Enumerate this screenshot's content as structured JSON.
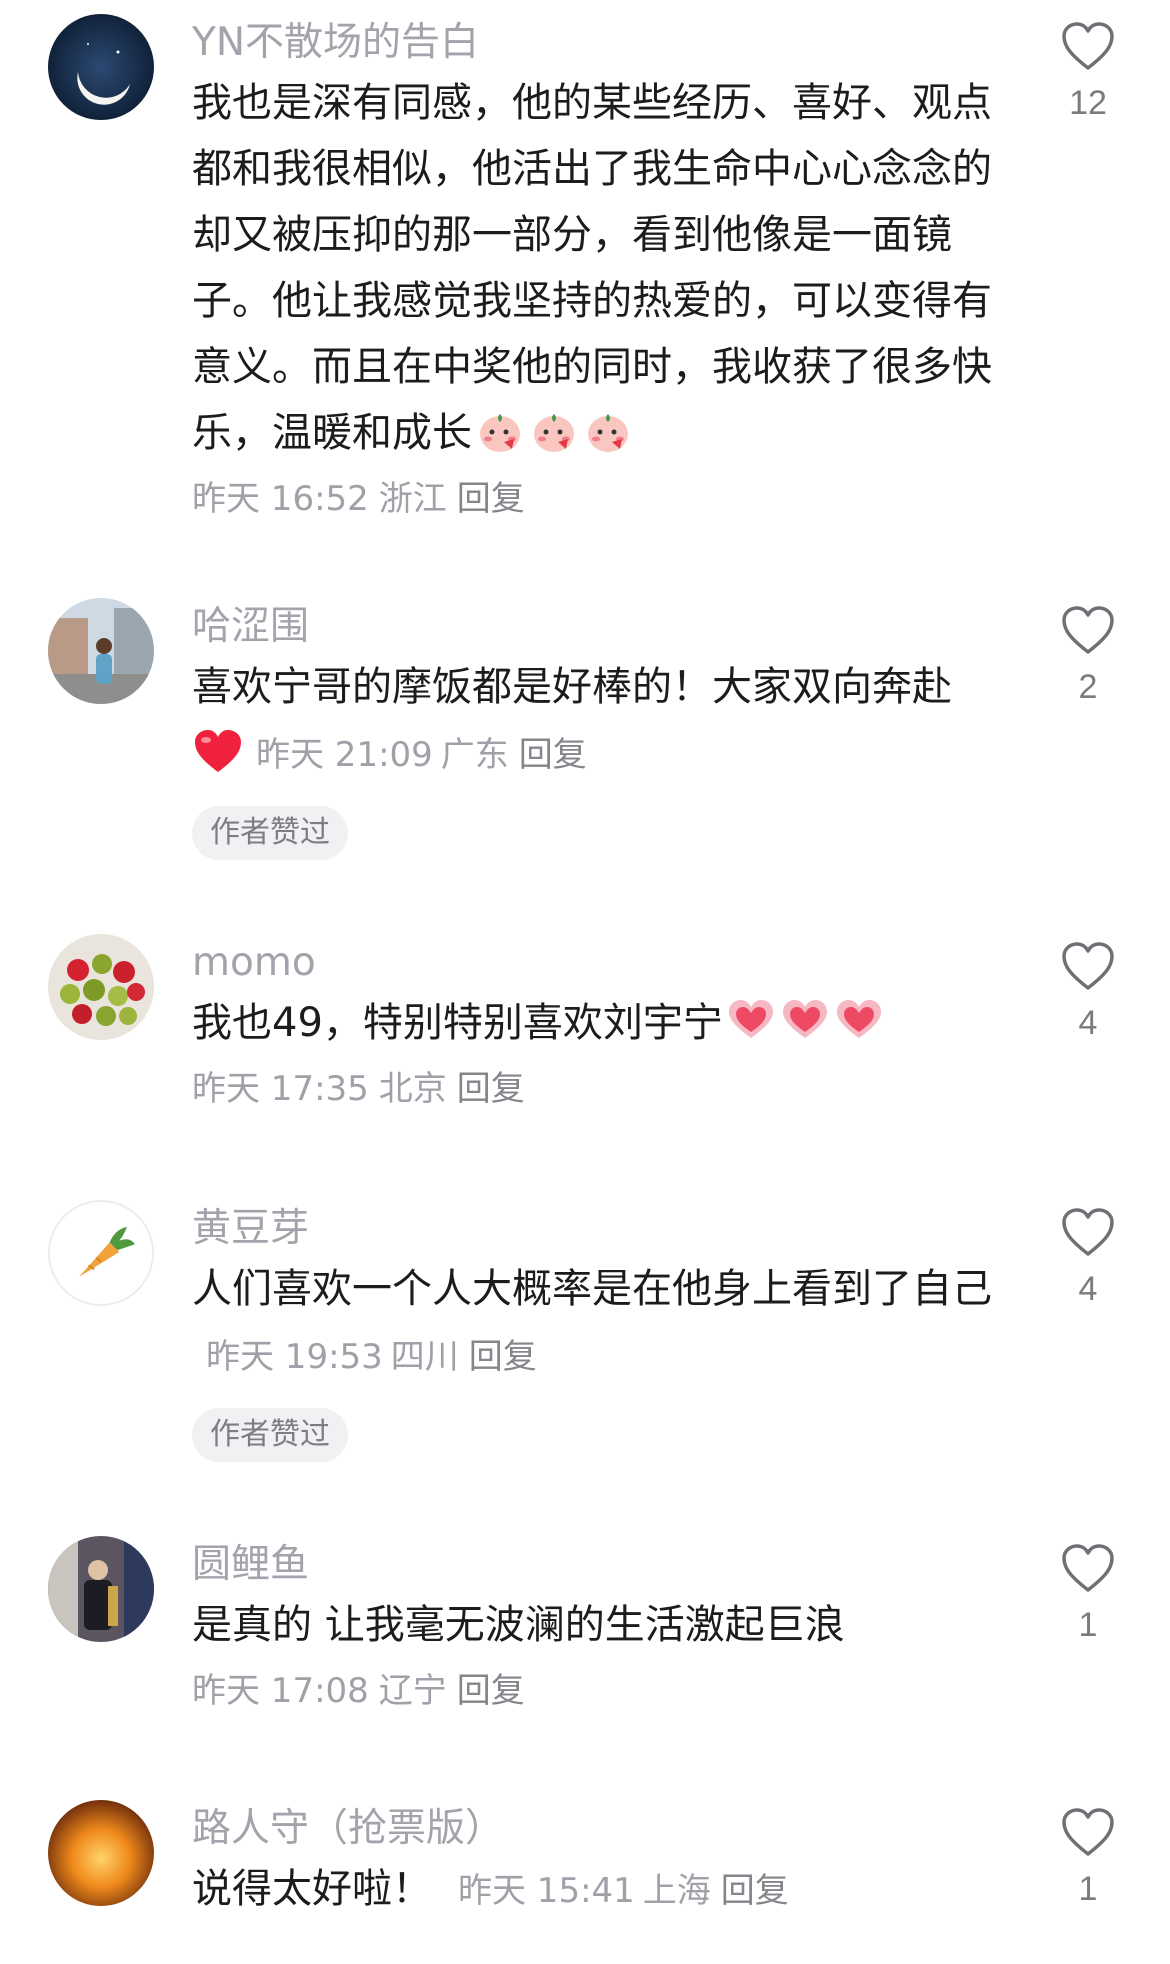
{
  "comments": [
    {
      "username": "YN不散场的告白",
      "text": "我也是深有同感，他的某些经历、喜好、观点都和我很相似，他活出了我生命中心心念念的却又被压抑的那一部分，看到他像是一面镜子。他让我感觉我坚持的热爱的，可以变得有意义。而且在中奖他的同时，我收获了很多快乐，温暖和成长",
      "time": "昨天 16:52",
      "location": "浙江",
      "reply": "回复",
      "likes": "12",
      "emoji": [
        "blushing-peach-emoji",
        "blushing-peach-emoji",
        "blushing-peach-emoji"
      ]
    },
    {
      "username": "哈涩围",
      "text": "喜欢宁哥的摩饭都是好棒的！大家双向奔赴",
      "time": "昨天 21:09",
      "location": "广东",
      "reply": "回复",
      "likes": "2",
      "badge": "作者赞过",
      "emoji": [
        "red-heart-emoji"
      ]
    },
    {
      "username": "momo",
      "text": "我也49，特别特别喜欢刘宇宁",
      "time": "昨天 17:35",
      "location": "北京",
      "reply": "回复",
      "likes": "4",
      "emoji": [
        "heart-hands-emoji",
        "heart-hands-emoji",
        "heart-hands-emoji"
      ]
    },
    {
      "username": "黄豆芽",
      "text": "人们喜欢一个人大概率是在他身上看到了自己",
      "time": "昨天 19:53",
      "location": "四川",
      "reply": "回复",
      "likes": "4",
      "badge": "作者赞过"
    },
    {
      "username": "圆鲤鱼",
      "text": "是真的 让我毫无波澜的生活激起巨浪",
      "time": "昨天 17:08",
      "location": "辽宁",
      "reply": "回复",
      "likes": "1"
    },
    {
      "username": "路人守（抢票版）",
      "text": "说得太好啦！",
      "time": "昨天 15:41",
      "location": "上海",
      "reply": "回复",
      "likes": "1"
    }
  ],
  "colors": {
    "username": "#a3a3ab",
    "text": "#1c1c1c",
    "meta": "#a0a0a8",
    "badge_bg": "#f1f1f3",
    "heart_outline": "#6f6f75"
  }
}
